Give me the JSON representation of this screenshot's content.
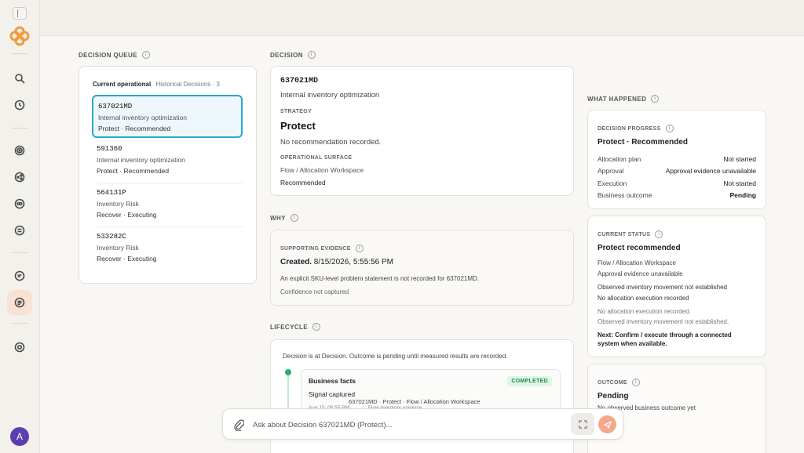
{
  "app": {
    "user_initial": "A",
    "accent": "#2aa6cf",
    "brand_color": "#f19a3e"
  },
  "rail": {
    "icons": [
      "sidebar-toggle-icon",
      "logo-icon",
      "search-icon",
      "clock-icon",
      "target-icon",
      "share-icon",
      "infinity-icon",
      "document-icon",
      "chat-icon",
      "decisions-icon",
      "home-icon"
    ]
  },
  "queue": {
    "section_label": "DECISION QUEUE",
    "tab_current": "Current operational",
    "tab_history": "Historical Decisions · 3",
    "items": [
      {
        "id": "637021MD",
        "title": "Internal inventory optimization",
        "status": "Protect · Recommended"
      },
      {
        "id": "591360",
        "title": "Internal inventory optimization",
        "status": "Protect · Recommended"
      },
      {
        "id": "564131P",
        "title": "Inventory Risk",
        "status": "Recover · Executing"
      },
      {
        "id": "533282C",
        "title": "Inventory Risk",
        "status": "Recover · Executing"
      }
    ]
  },
  "decision": {
    "section_label": "DECISION",
    "id": "637021MD",
    "title": "Internal inventory optimization",
    "strategy_label": "STRATEGY",
    "strategy": "Protect",
    "strategy_note": "No recommendation recorded.",
    "surface_label": "OPERATIONAL SURFACE",
    "surface": "Flow / Allocation Workspace",
    "surface_status": "Recommended"
  },
  "why": {
    "section_label": "WHY",
    "evidence_label": "SUPPORTING EVIDENCE",
    "created": "Created.",
    "created_date": "8/15/2026, 5:55:56 PM",
    "statement": "An explicit SKU-level problem statement is not recorded for 637021MD.",
    "confidence": "Confidence not captured"
  },
  "lifecycle": {
    "section_label": "LIFECYCLE",
    "summary": "Decision is at Decision. Outcome is pending until measured results are recorded.",
    "fact_title": "Business facts",
    "fact_badge": "COMPLETED",
    "fact_event": "Signal captured",
    "fact_detail": "637021MD · Protect · Flow / Allocation Workspace",
    "fact_time": "Aug 15, 05:55 PM",
    "fact_universe": "Flow inventory universe"
  },
  "what_happened": {
    "section_label": "WHAT HAPPENED",
    "progress_label": "DECISION PROGRESS",
    "progress_title": "Protect · Recommended",
    "progress_rows": [
      {
        "k": "Allocation plan",
        "v": "Not started"
      },
      {
        "k": "Approval",
        "v": "Approval evidence unavailable"
      },
      {
        "k": "Execution",
        "v": "Not started"
      },
      {
        "k": "Business outcome",
        "v": "Pending"
      }
    ],
    "status_label": "CURRENT STATUS",
    "status_title": "Protect recommended",
    "status_lines": [
      "Flow / Allocation Workspace",
      "Approval evidence unavailable",
      "Observed inventory movement not established",
      "No allocation execution recorded"
    ],
    "status_notes": [
      "No allocation execution recorded.",
      "Observed inventory movement not established."
    ],
    "status_next": "Next: Confirm / execute through a connected system when available.",
    "outcome_label": "OUTCOME",
    "outcome_title": "Pending",
    "outcome_note": "No observed business outcome yet"
  },
  "ask": {
    "placeholder": "Ask about Decision 637021MD (Protect)..."
  }
}
